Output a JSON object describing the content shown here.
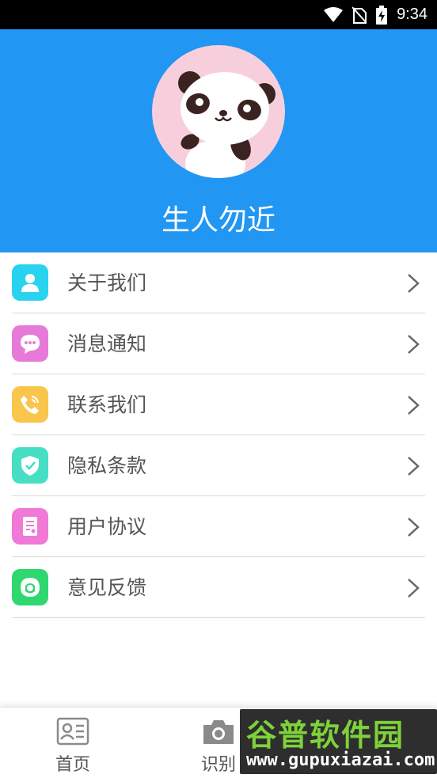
{
  "status_bar": {
    "time": "9:34",
    "icons": [
      "wifi-icon",
      "no-sim-icon",
      "battery-charging-icon"
    ]
  },
  "profile": {
    "avatar": "panda-avatar",
    "name": "生人勿近"
  },
  "menu": {
    "items": [
      {
        "label": "关于我们",
        "icon": "person-icon",
        "color": "#29d3f0"
      },
      {
        "label": "消息通知",
        "icon": "chat-bubble-icon",
        "color": "#e77ad9"
      },
      {
        "label": "联系我们",
        "icon": "phone-icon",
        "color": "#f8c64c"
      },
      {
        "label": "隐私条款",
        "icon": "shield-check-icon",
        "color": "#46dfc3"
      },
      {
        "label": "用户协议",
        "icon": "document-icon",
        "color": "#f078d6"
      },
      {
        "label": "意见反馈",
        "icon": "feedback-person-icon",
        "color": "#2ed86f"
      }
    ]
  },
  "tabbar": {
    "tabs": [
      {
        "label": "首页",
        "icon": "id-card-icon"
      },
      {
        "label": "识别",
        "icon": "camera-icon"
      }
    ]
  },
  "watermark": {
    "title": "谷普软件园",
    "url": "www.gupuxiazai.com"
  },
  "colors": {
    "header": "#2196f3",
    "status_bar": "#000000",
    "text": "#555555",
    "divider": "#d9d9d9"
  }
}
